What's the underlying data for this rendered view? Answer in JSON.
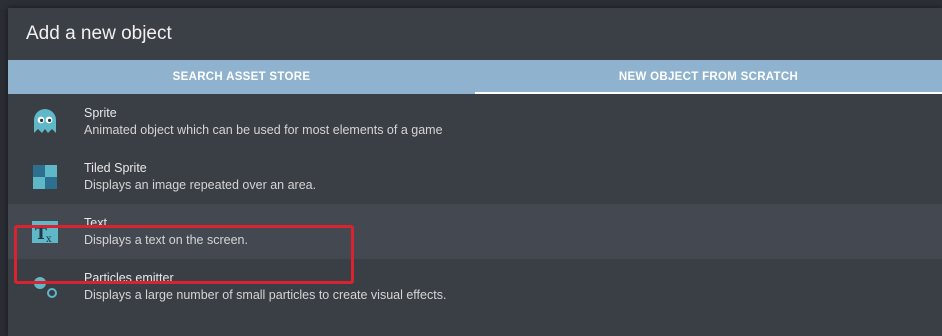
{
  "dialog": {
    "title": "Add a new object"
  },
  "tabs": [
    {
      "label": "SEARCH ASSET STORE",
      "active": false
    },
    {
      "label": "NEW OBJECT FROM SCRATCH",
      "active": true
    }
  ],
  "objects": [
    {
      "name": "Sprite",
      "description": "Animated object which can be used for most elements of a game",
      "icon": "ghost-sprite-icon"
    },
    {
      "name": "Tiled Sprite",
      "description": "Displays an image repeated over an area.",
      "icon": "tiled-sprite-icon"
    },
    {
      "name": "Text",
      "description": "Displays a text on the screen.",
      "icon": "text-object-icon"
    },
    {
      "name": "Particles emitter",
      "description": "Displays a large number of small particles to create visual effects.",
      "icon": "particles-emitter-icon"
    }
  ],
  "colors": {
    "accent": "#8fb3cf",
    "highlight_border": "#d9232e",
    "icon_teal": "#5fb8c8"
  }
}
